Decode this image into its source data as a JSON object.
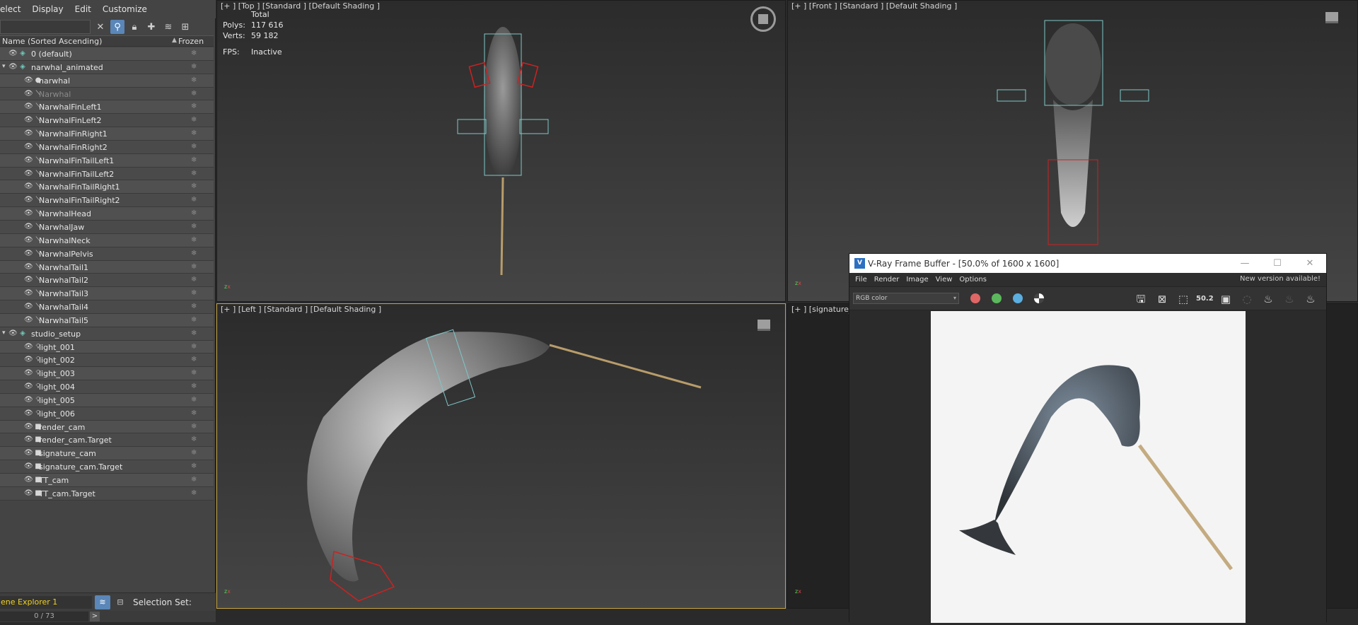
{
  "menubar": {
    "items": [
      "elect",
      "Display",
      "Edit",
      "Customize"
    ]
  },
  "explorer": {
    "columns": {
      "name": "Name (Sorted Ascending)",
      "frozen": "Frozen"
    },
    "rows": [
      {
        "label": "0 (default)",
        "indent": 0,
        "icon": "layer-icon",
        "expand": ""
      },
      {
        "label": "narwhal_animated",
        "indent": 0,
        "icon": "layer-icon",
        "expand": "▾"
      },
      {
        "label": "narwhal",
        "indent": 1,
        "icon": "sphere-icon",
        "expand": ""
      },
      {
        "label": "Narwhal",
        "indent": 1,
        "icon": "bone-icon",
        "expand": "",
        "dim": true
      },
      {
        "label": "NarwhalFinLeft1",
        "indent": 1,
        "icon": "bone-icon"
      },
      {
        "label": "NarwhalFinLeft2",
        "indent": 1,
        "icon": "bone-icon"
      },
      {
        "label": "NarwhalFinRight1",
        "indent": 1,
        "icon": "bone-icon"
      },
      {
        "label": "NarwhalFinRight2",
        "indent": 1,
        "icon": "bone-icon"
      },
      {
        "label": "NarwhalFinTailLeft1",
        "indent": 1,
        "icon": "bone-icon"
      },
      {
        "label": "NarwhalFinTailLeft2",
        "indent": 1,
        "icon": "bone-icon"
      },
      {
        "label": "NarwhalFinTailRight1",
        "indent": 1,
        "icon": "bone-icon"
      },
      {
        "label": "NarwhalFinTailRight2",
        "indent": 1,
        "icon": "bone-icon"
      },
      {
        "label": "NarwhalHead",
        "indent": 1,
        "icon": "bone-icon"
      },
      {
        "label": "NarwhalJaw",
        "indent": 1,
        "icon": "bone-icon"
      },
      {
        "label": "NarwhalNeck",
        "indent": 1,
        "icon": "bone-icon"
      },
      {
        "label": "NarwhalPelvis",
        "indent": 1,
        "icon": "bone-icon"
      },
      {
        "label": "NarwhalTail1",
        "indent": 1,
        "icon": "bone-icon"
      },
      {
        "label": "NarwhalTail2",
        "indent": 1,
        "icon": "bone-icon"
      },
      {
        "label": "NarwhalTail3",
        "indent": 1,
        "icon": "bone-icon"
      },
      {
        "label": "NarwhalTail4",
        "indent": 1,
        "icon": "bone-icon"
      },
      {
        "label": "NarwhalTail5",
        "indent": 1,
        "icon": "bone-icon"
      },
      {
        "label": "studio_setup",
        "indent": 0,
        "icon": "layer-icon",
        "expand": "▾"
      },
      {
        "label": "light_001",
        "indent": 1,
        "icon": "light-icon"
      },
      {
        "label": "light_002",
        "indent": 1,
        "icon": "light-icon"
      },
      {
        "label": "light_003",
        "indent": 1,
        "icon": "light-icon"
      },
      {
        "label": "light_004",
        "indent": 1,
        "icon": "light-icon"
      },
      {
        "label": "light_005",
        "indent": 1,
        "icon": "light-icon"
      },
      {
        "label": "light_006",
        "indent": 1,
        "icon": "light-icon"
      },
      {
        "label": "render_cam",
        "indent": 1,
        "icon": "camera-icon"
      },
      {
        "label": "render_cam.Target",
        "indent": 1,
        "icon": "camera-icon"
      },
      {
        "label": "signature_cam",
        "indent": 1,
        "icon": "camera-icon"
      },
      {
        "label": "signature_cam.Target",
        "indent": 1,
        "icon": "camera-icon"
      },
      {
        "label": "TT_cam",
        "indent": 1,
        "icon": "camera-icon"
      },
      {
        "label": "TT_cam.Target",
        "indent": 1,
        "icon": "camera-icon"
      }
    ],
    "footer": {
      "explorer_name": "ene Explorer 1",
      "selection_set_label": "Selection Set:",
      "counter": "0 / 73",
      "next": ">"
    }
  },
  "viewports": {
    "top": {
      "label": "[+ ]  [Top ]  [Standard ]  [Default Shading ]"
    },
    "front": {
      "label": "[+ ]  [Front ]  [Standard ]  [Default Shading ]"
    },
    "left": {
      "label": "[+ ]  [Left ]  [Standard ]  [Default Shading ]"
    },
    "signature": {
      "label": "[+ ]  [signature_ca"
    },
    "stats": {
      "total_label": "Total",
      "polys_label": "Polys:",
      "polys_value": "117 616",
      "verts_label": "Verts:",
      "verts_value": "59 182",
      "fps_label": "FPS:",
      "fps_value": "Inactive"
    }
  },
  "vfb": {
    "title": "V-Ray Frame Buffer - [50.0% of 1600 x 1600]",
    "menu": [
      "File",
      "Render",
      "Image",
      "View",
      "Options"
    ],
    "update_notice": "New version available!",
    "channel": "RGB color",
    "zoom_badge": "50.2",
    "colors": {
      "red": "#e06666",
      "green": "#5cb85c",
      "blue": "#5aaee0"
    }
  }
}
